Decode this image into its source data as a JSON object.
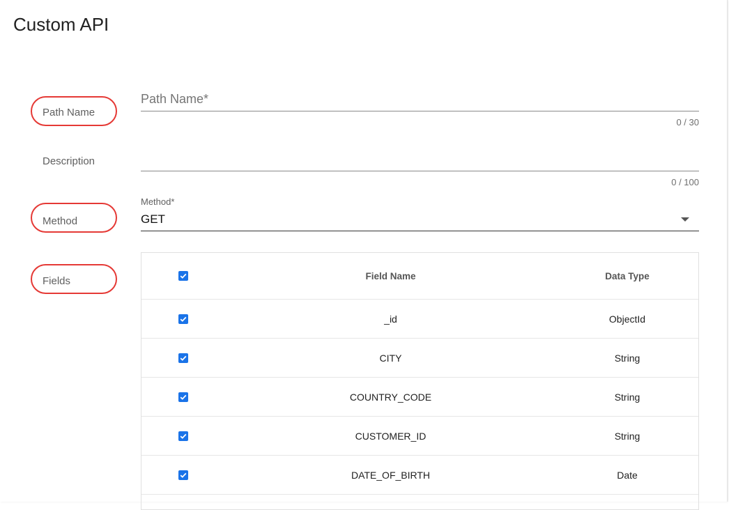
{
  "dialog": {
    "title": "Custom API"
  },
  "labels": {
    "path_name": "Path Name",
    "description": "Description",
    "method": "Method",
    "fields": "Fields"
  },
  "path_name_input": {
    "placeholder": "Path Name*",
    "value": "",
    "counter": "0 / 30"
  },
  "description_input": {
    "placeholder": "",
    "value": "",
    "counter": "0 / 100"
  },
  "method_select": {
    "label": "Method*",
    "value": "GET"
  },
  "fields_table": {
    "headers": {
      "field_name": "Field Name",
      "data_type": "Data Type"
    },
    "rows": [
      {
        "field_name": "_id",
        "data_type": "ObjectId",
        "checked": true
      },
      {
        "field_name": "CITY",
        "data_type": "String",
        "checked": true
      },
      {
        "field_name": "COUNTRY_CODE",
        "data_type": "String",
        "checked": true
      },
      {
        "field_name": "CUSTOMER_ID",
        "data_type": "String",
        "checked": true
      },
      {
        "field_name": "DATE_OF_BIRTH",
        "data_type": "Date",
        "checked": true
      }
    ]
  },
  "colors": {
    "accent": "#1a73e8",
    "highlight": "#e53935",
    "underline": "#8a8a8a"
  },
  "icons": {
    "checkbox": "check-icon",
    "select_caret": "caret-down-icon"
  }
}
